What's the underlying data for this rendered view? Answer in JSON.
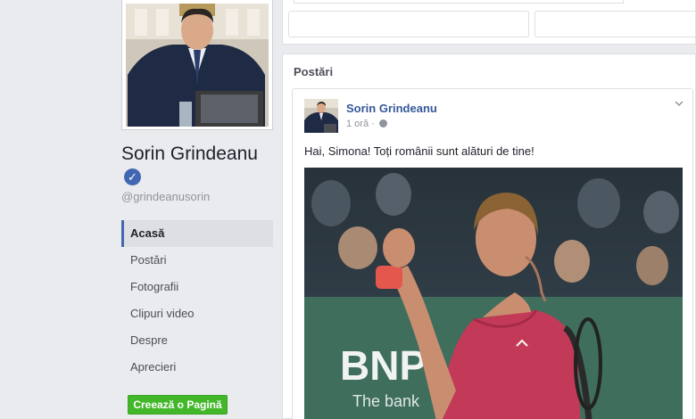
{
  "profile": {
    "name": "Sorin Grindeanu",
    "handle": "@grindeanusorin"
  },
  "nav": {
    "items": [
      {
        "label": "Acasă",
        "active": true
      },
      {
        "label": "Postări",
        "active": false
      },
      {
        "label": "Fotografii",
        "active": false
      },
      {
        "label": "Clipuri video",
        "active": false
      },
      {
        "label": "Despre",
        "active": false
      },
      {
        "label": "Aprecieri",
        "active": false
      }
    ],
    "create_page_label": "Creează o Pagină"
  },
  "posts": {
    "heading": "Postări",
    "items": [
      {
        "author": "Sorin Grindeanu",
        "time": "1 oră",
        "text": "Hai, Simona! Toți românii sunt alături de tine!",
        "image_banner_text": "BNP",
        "image_banner_sub": "The bank"
      }
    ]
  },
  "colors": {
    "link": "#365899",
    "accent": "#4267b2",
    "green_button": "#42b72a",
    "page_bg": "#e9ebee"
  }
}
